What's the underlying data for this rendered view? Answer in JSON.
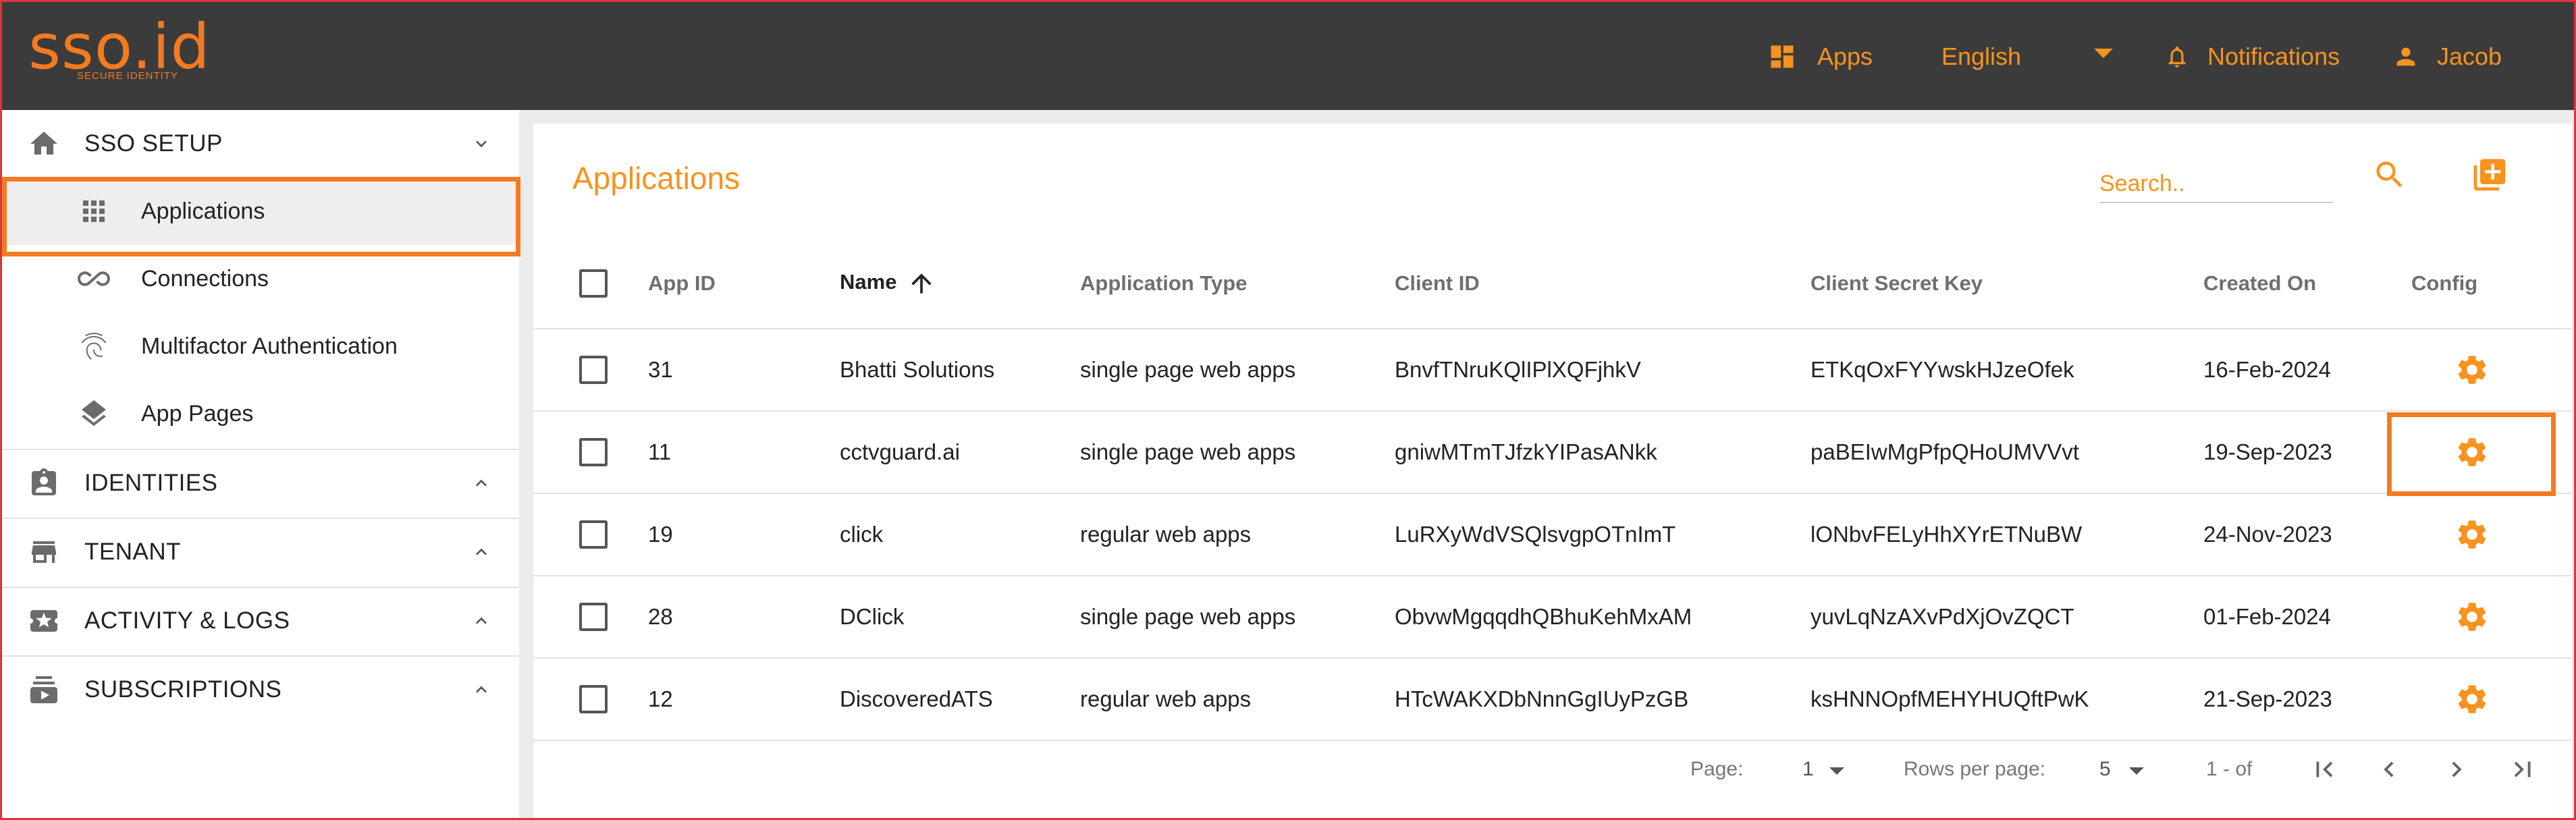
{
  "header": {
    "logo_text": "sso.id",
    "logo_sub": "SECURE IDENTITY",
    "apps_label": "Apps",
    "language": "English",
    "notifications_label": "Notifications",
    "user_name": "Jacob"
  },
  "sidebar": {
    "sso_setup": "SSO SETUP",
    "sub_items": [
      "Applications",
      "Connections",
      "Multifactor Authentication",
      "App Pages"
    ],
    "identities": "IDENTITIES",
    "tenant": "TENANT",
    "activity": "ACTIVITY & LOGS",
    "subscriptions": "SUBSCRIPTIONS"
  },
  "main": {
    "title": "Applications",
    "search_placeholder": "Search..",
    "columns": [
      "App ID",
      "Name",
      "Application Type",
      "Client ID",
      "Client Secret Key",
      "Created On",
      "Config"
    ],
    "rows": [
      {
        "id": "31",
        "name": "Bhatti Solutions",
        "type": "single page web apps",
        "client_id": "BnvfTNruKQlIPlXQFjhkV",
        "secret": "ETKqOxFYYwskHJzeOfek",
        "created": "16-Feb-2024"
      },
      {
        "id": "11",
        "name": "cctvguard.ai",
        "type": "single page web apps",
        "client_id": "gniwMTmTJfzkYIPasANkk",
        "secret": "paBEIwMgPfpQHoUMVVvt",
        "created": "19-Sep-2023"
      },
      {
        "id": "19",
        "name": "click",
        "type": "regular web apps",
        "client_id": "LuRXyWdVSQlsvgpOTnImT",
        "secret": "lONbvFELyHhXYrETNuBW",
        "created": "24-Nov-2023"
      },
      {
        "id": "28",
        "name": "DClick",
        "type": "single page web apps",
        "client_id": "ObvwMgqqdhQBhuKehMxAM",
        "secret": "yuvLqNzAXvPdXjOvZQCT",
        "created": "01-Feb-2024"
      },
      {
        "id": "12",
        "name": "DiscoveredATS",
        "type": "regular web apps",
        "client_id": "HTcWAKXDbNnnGgIUyPzGB",
        "secret": "ksHNNOpfMEHYHUQftPwK",
        "created": "21-Sep-2023"
      }
    ],
    "pagination": {
      "page_label": "Page:",
      "page_value": "1",
      "rows_label": "Rows per page:",
      "rows_value": "5",
      "range": "1 - of"
    }
  },
  "colors": {
    "accent": "#f7931e",
    "highlight": "#f47b20",
    "header_bg": "#3b3b3b"
  }
}
